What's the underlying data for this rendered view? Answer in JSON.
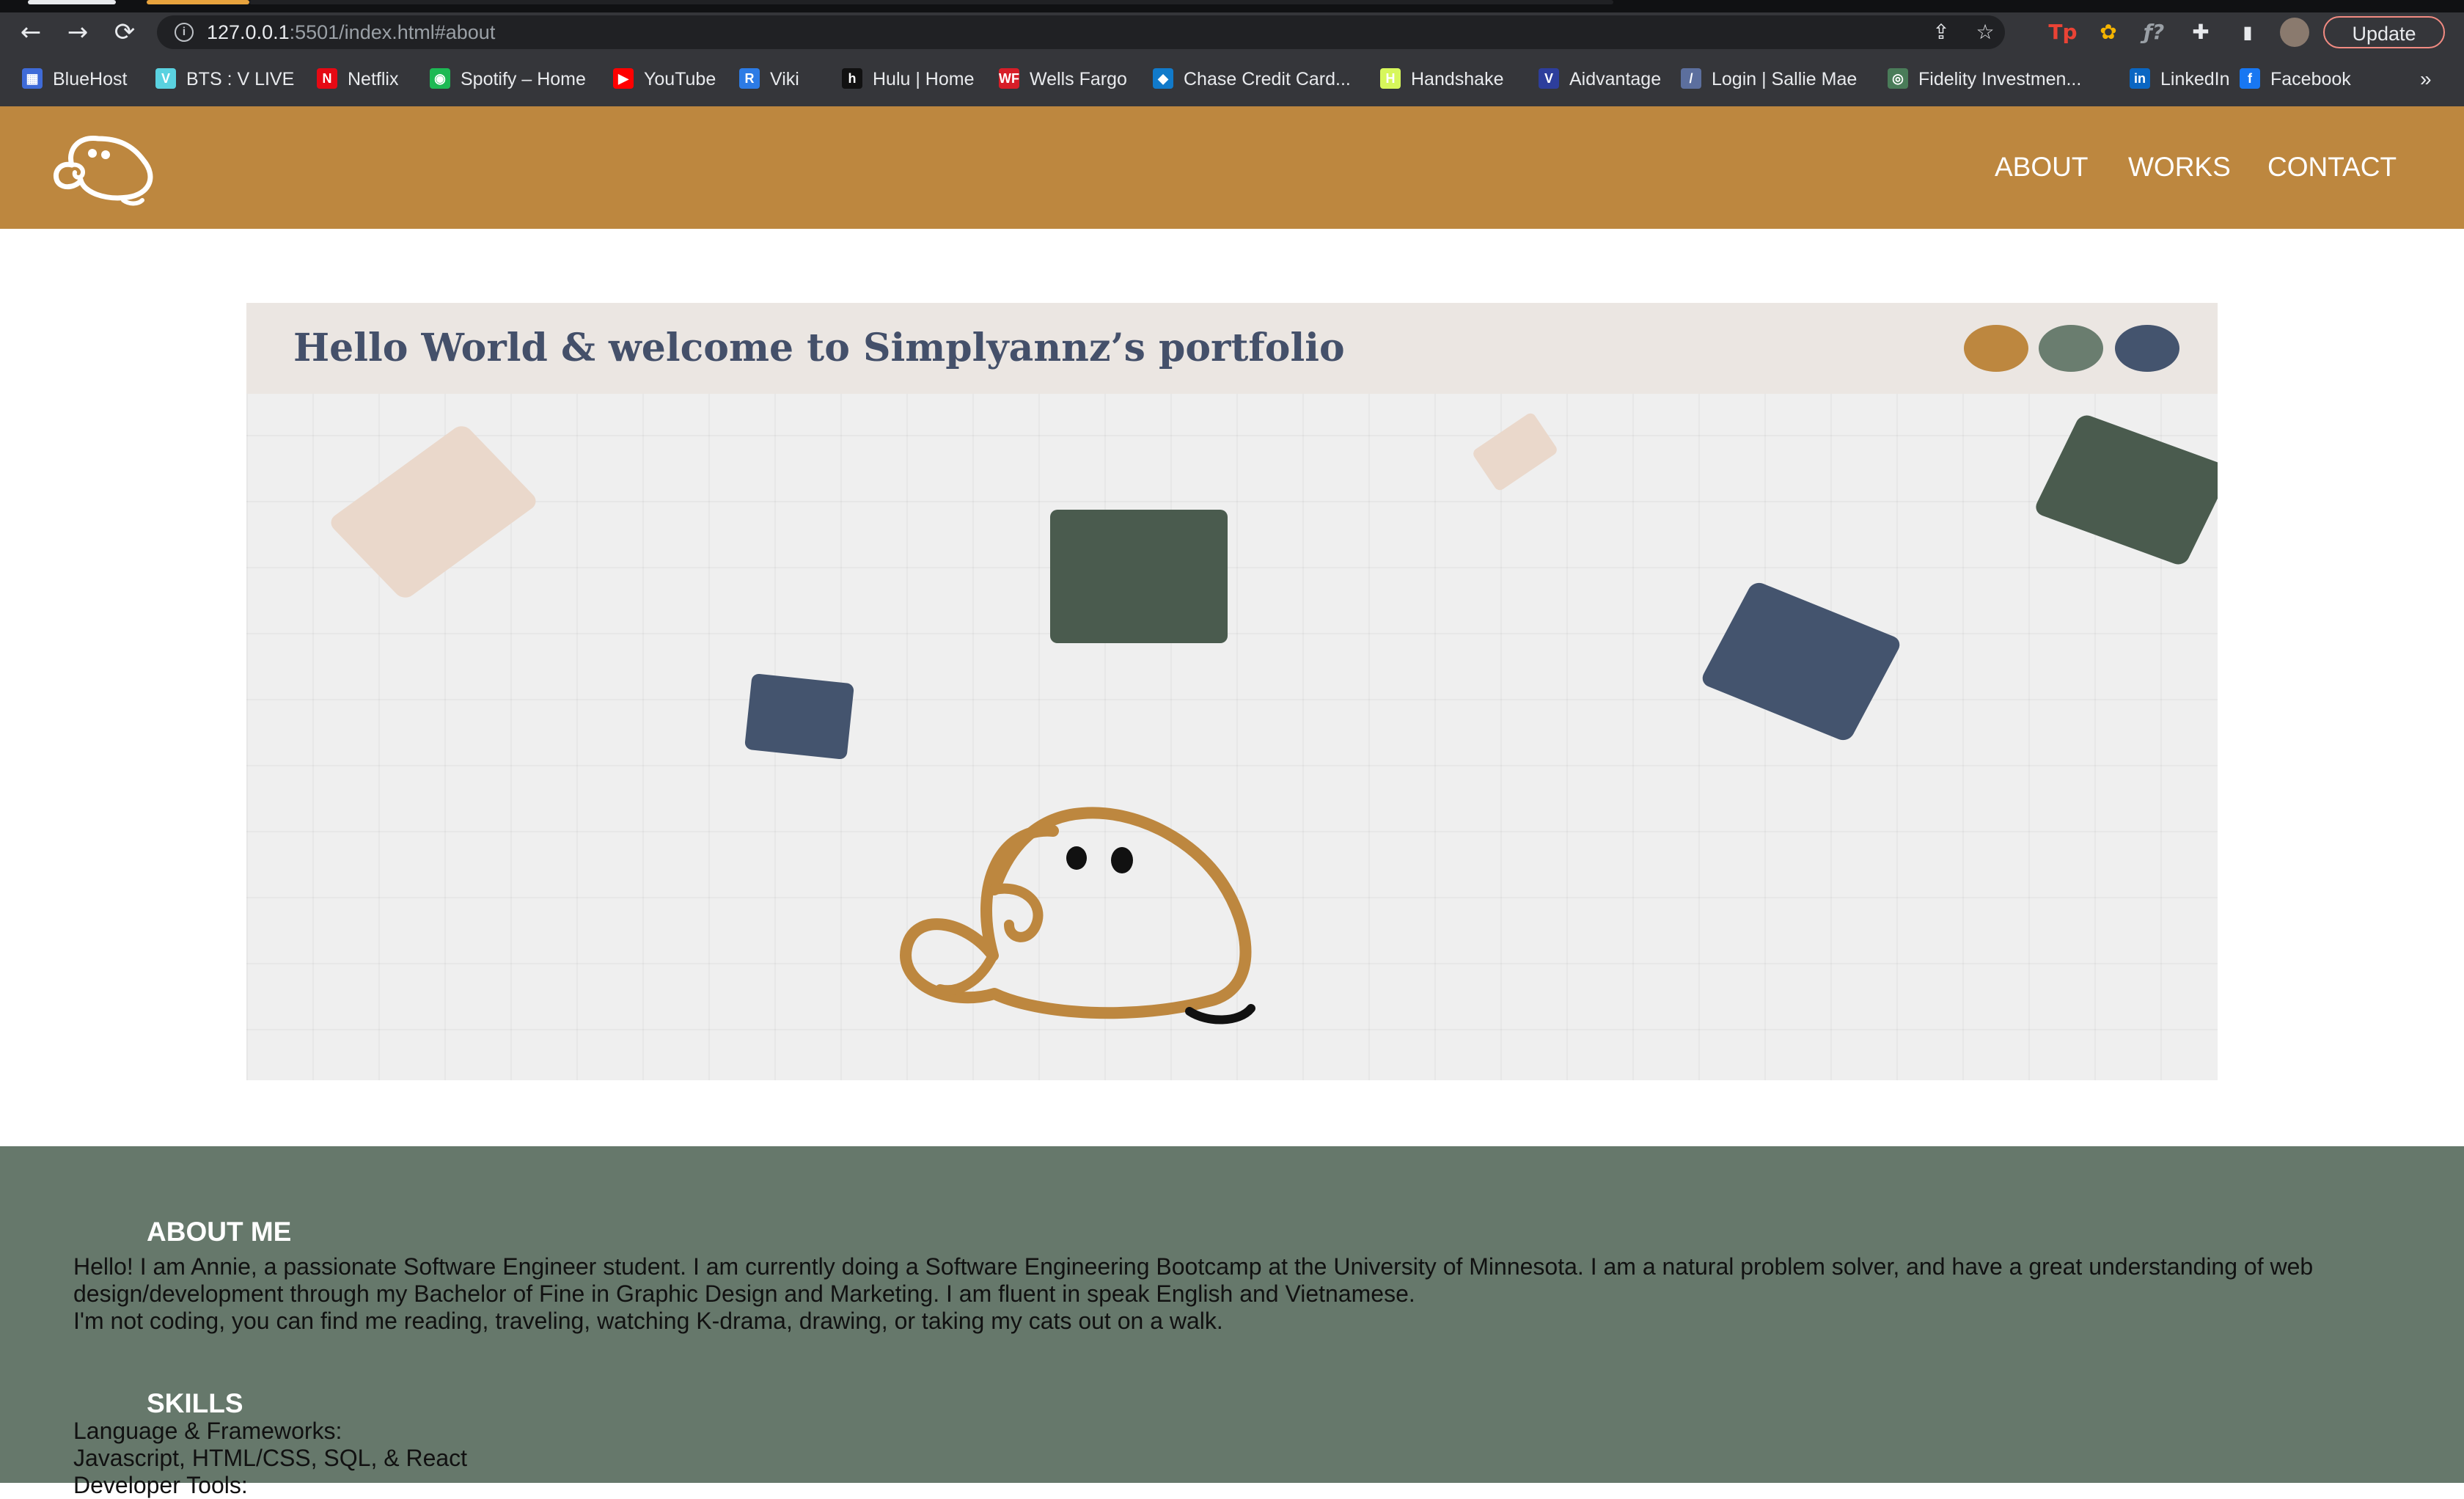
{
  "browser": {
    "url_host": "127.0.0.1",
    "url_path": ":5501/index.html#about",
    "update_label": "Update",
    "nav": {
      "back": "←",
      "forward": "→",
      "reload": "⟳"
    },
    "extensions": [
      "Tp",
      "✿",
      "ƒ?",
      "✚",
      "▮"
    ],
    "bookmarks": [
      {
        "label": "BlueHost",
        "fav": "▦",
        "color": "#3f6bd8"
      },
      {
        "label": "BTS : V LIVE",
        "fav": "V",
        "color": "#5ad2e0"
      },
      {
        "label": "Netflix",
        "fav": "N",
        "color": "#e50914"
      },
      {
        "label": "Spotify – Home",
        "fav": "◉",
        "color": "#1db954"
      },
      {
        "label": "YouTube",
        "fav": "▶",
        "color": "#ff0000"
      },
      {
        "label": "Viki",
        "fav": "R",
        "color": "#2c7be5"
      },
      {
        "label": "Hulu | Home",
        "fav": "h",
        "color": "#111111"
      },
      {
        "label": "Wells Fargo",
        "fav": "WF",
        "color": "#d71e28"
      },
      {
        "label": "Chase Credit Card...",
        "fav": "◆",
        "color": "#117aca"
      },
      {
        "label": "Handshake",
        "fav": "H",
        "color": "#d7f75b"
      },
      {
        "label": "Aidvantage",
        "fav": "V",
        "color": "#2d3e9c"
      },
      {
        "label": "Login | Sallie Mae",
        "fav": "/",
        "color": "#5c6f9e"
      },
      {
        "label": "Fidelity Investmen...",
        "fav": "◎",
        "color": "#4a7c59"
      },
      {
        "label": "LinkedIn",
        "fav": "in",
        "color": "#0a66c2"
      },
      {
        "label": "Facebook",
        "fav": "f",
        "color": "#1877f2"
      }
    ],
    "more": "»"
  },
  "site": {
    "nav": [
      "ABOUT",
      "WORKS",
      "CONTACT"
    ],
    "hero_title": "Hello World & welcome to Simplyannz’s portfolio",
    "colors": {
      "header": "#bd873f",
      "about_bg": "#66786b",
      "dot1": "#bd873f",
      "dot2": "#6a7d6f",
      "dot3": "#44546e"
    },
    "about": {
      "heading": "ABOUT ME",
      "line1": "Hello! I am Annie, a passionate Software Engineer student. I am currently doing a Software Engineering Bootcamp at the University of Minnesota. I am a natural problem solver, and have a great understanding of web",
      "line2": "design/development through my Bachelor of Fine in Graphic Design and Marketing. I am fluent in speak English and Vietnamese.",
      "line3": "I'm not coding, you can find me reading, traveling, watching K-drama, drawing, or taking my cats out on a walk."
    },
    "skills": {
      "heading": "SKILLS",
      "line1": "Language & Frameworks:",
      "line2": "Javascript, HTML/CSS, SQL, & React",
      "line3": "Developer Tools:"
    }
  }
}
